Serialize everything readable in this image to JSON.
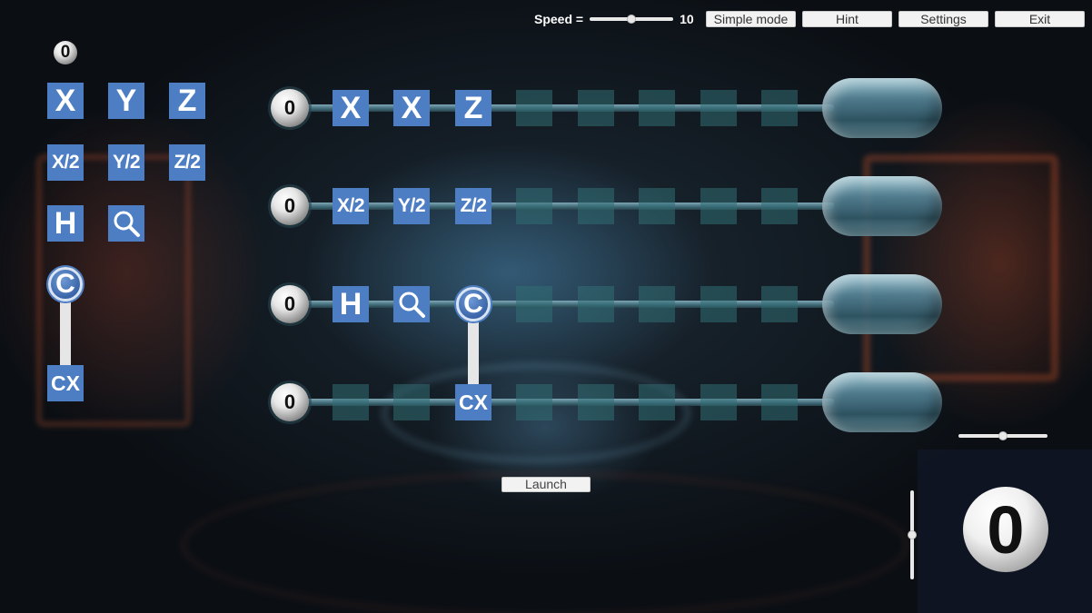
{
  "topbar": {
    "speed_label": "Speed =",
    "speed_value": "10",
    "speed_level": 0.5,
    "buttons": [
      "Simple mode",
      "Hint",
      "Settings",
      "Exit"
    ]
  },
  "palette": {
    "counter": "0",
    "gates": [
      "X",
      "Y",
      "Z",
      "X/2",
      "Y/2",
      "Z/2",
      "H"
    ],
    "search_icon": "magnifier-icon",
    "control_label": "C",
    "target_label": "CX"
  },
  "circuit": {
    "qubits": [
      {
        "state": "0",
        "gates": [
          "X",
          "X",
          "Z",
          "",
          "",
          "",
          "",
          ""
        ]
      },
      {
        "state": "0",
        "gates": [
          "X/2",
          "Y/2",
          "Z/2",
          "",
          "",
          "",
          "",
          ""
        ]
      },
      {
        "state": "0",
        "gates": [
          "H",
          "magnifier",
          "C",
          "",
          "",
          "",
          "",
          ""
        ]
      },
      {
        "state": "0",
        "gates": [
          "",
          "",
          "CX",
          "",
          "",
          "",
          "",
          ""
        ]
      }
    ]
  },
  "launch_label": "Launch",
  "result": {
    "value": "0"
  },
  "sliders": {
    "horizontal_level": 0.5,
    "vertical_level": 0.5
  },
  "colors": {
    "gate": "#4d7ec4",
    "empty_slot": "#2f6e72"
  }
}
